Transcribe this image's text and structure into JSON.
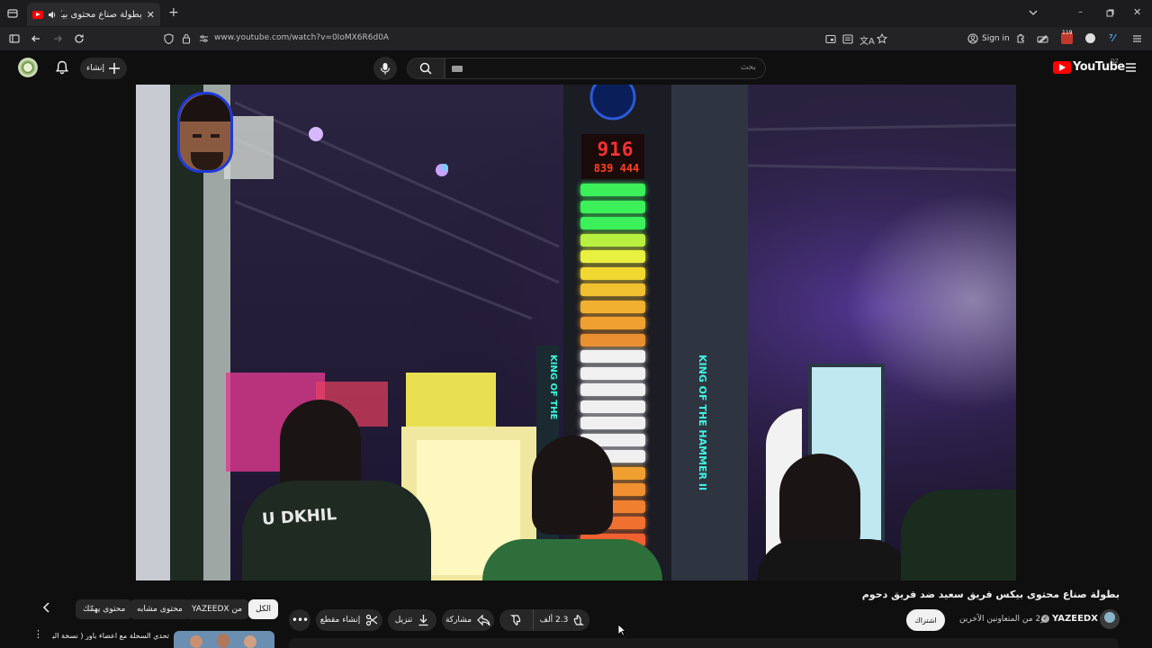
{
  "browser": {
    "tab_title": "بطولة صناع محتوى بيكس فر",
    "url": "www.youtube.com/watch?v=0IoMX6R6d0A",
    "sign_in": "Sign in",
    "badge_count": "119"
  },
  "header": {
    "create_label": "إنشاء",
    "search_placeholder": "بحث",
    "logo_text": "YouTube",
    "logo_region": "DZ"
  },
  "video": {
    "score_top": "916",
    "score_bottom": "839 444",
    "sign_left": "KING OF THE",
    "sign_right": "KING OF THE HAMMER II",
    "shirt_text": "U DKHIL"
  },
  "details": {
    "title": "بطولة صناع محتوى بيكس فريق سعيد ضد فريق دحوم",
    "channel_name": "YAZEEDX",
    "collaborators": "و2 من المتعاونين الآخرين",
    "subscribe_label": "اشتراك",
    "like_count": "2.3 ألف",
    "share_label": "مشاركة",
    "download_label": "تنزيل",
    "clip_label": "إنشاء مقطع"
  },
  "related_chips": {
    "all": "الكل",
    "from_channel": "من YAZEEDX",
    "similar": "محتوى مشابه",
    "for_you": "محتوى يهمّك"
  },
  "next_video": {
    "title": "تحدي السحلة مع اعضاء باور ( نسخة الباص )"
  },
  "colors": {
    "accent_red": "#ff0000",
    "panel": "#272727",
    "background": "#0f0f0f"
  }
}
